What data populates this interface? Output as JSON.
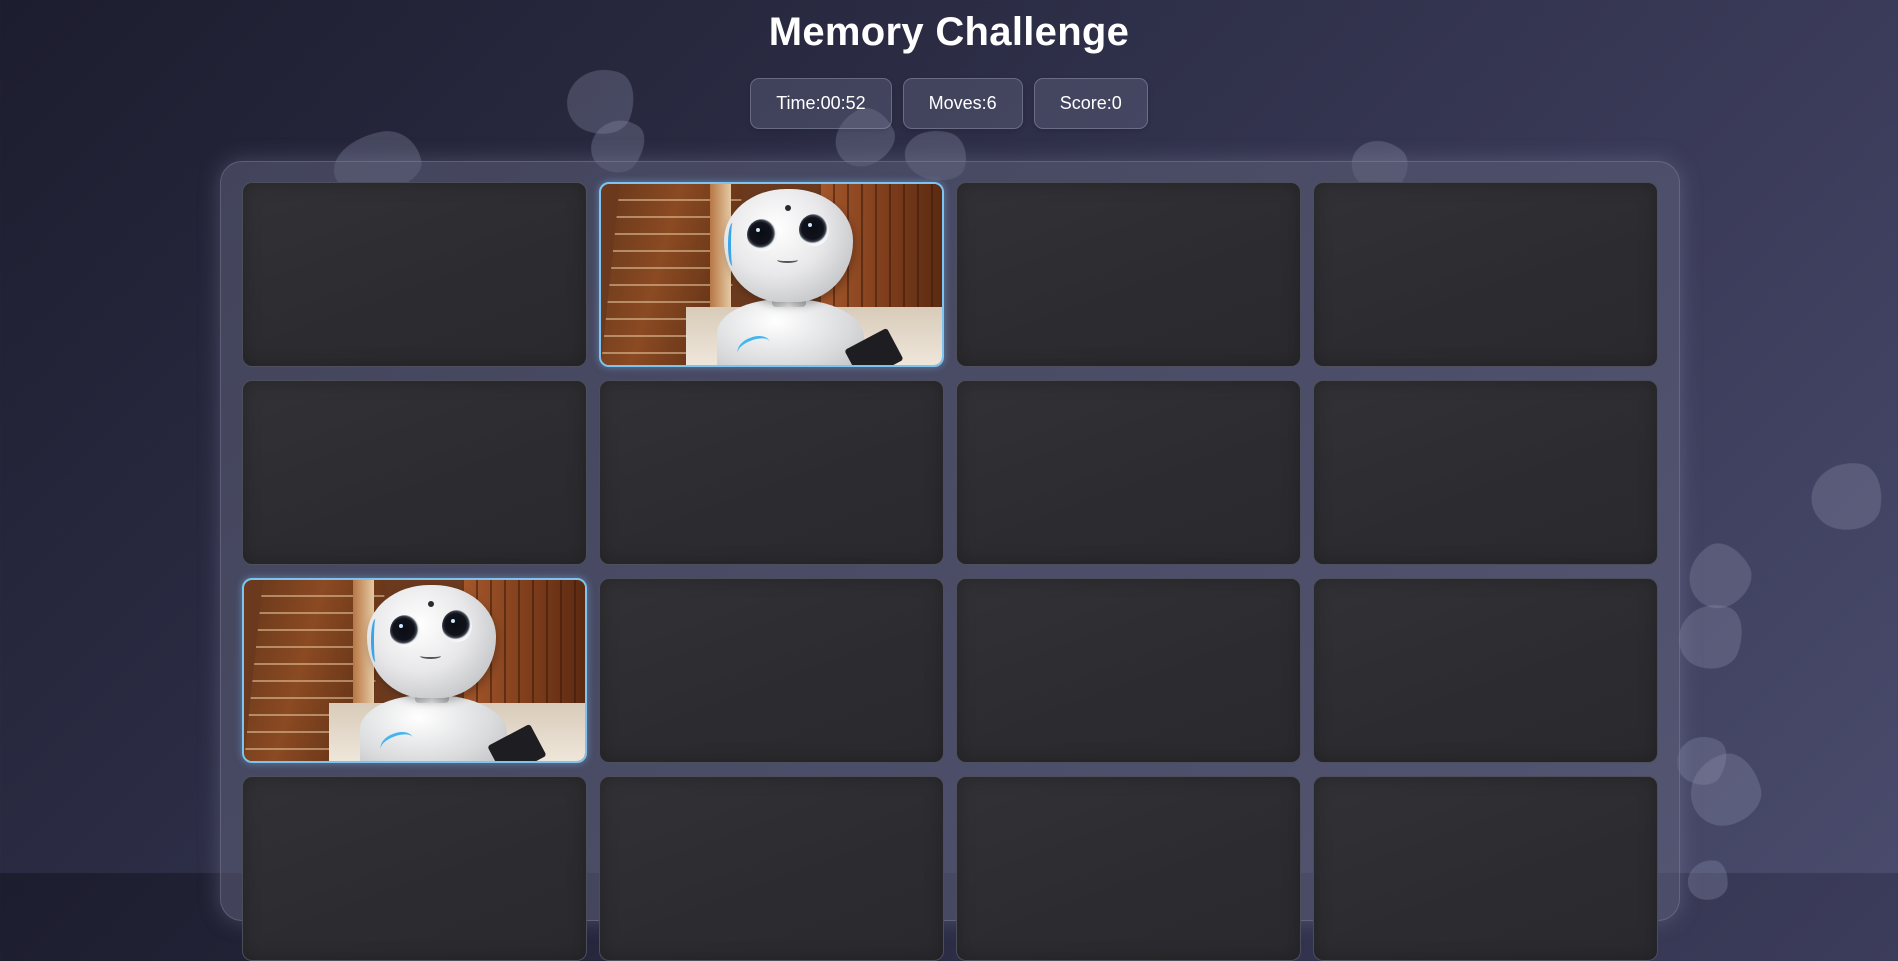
{
  "title": "Memory Challenge",
  "stats": {
    "time": {
      "label": "Time",
      "value": "00:52"
    },
    "moves": {
      "label": "Moves",
      "value": "6"
    },
    "score": {
      "label": "Score",
      "value": "0"
    }
  },
  "board": {
    "columns": 4,
    "cards": [
      {
        "state": "face-down",
        "icon": "card-back"
      },
      {
        "state": "face-up",
        "icon": "robot-photo"
      },
      {
        "state": "face-down",
        "icon": "card-back"
      },
      {
        "state": "face-down",
        "icon": "card-back"
      },
      {
        "state": "face-down",
        "icon": "card-back"
      },
      {
        "state": "face-down",
        "icon": "card-back"
      },
      {
        "state": "face-down",
        "icon": "card-back"
      },
      {
        "state": "face-down",
        "icon": "card-back"
      },
      {
        "state": "face-up",
        "icon": "robot-photo"
      },
      {
        "state": "face-down",
        "icon": "card-back"
      },
      {
        "state": "face-down",
        "icon": "card-back"
      },
      {
        "state": "face-down",
        "icon": "card-back"
      },
      {
        "state": "face-down",
        "icon": "card-back"
      },
      {
        "state": "face-down",
        "icon": "card-back"
      },
      {
        "state": "face-down",
        "icon": "card-back"
      },
      {
        "state": "face-down",
        "icon": "card-back"
      }
    ]
  },
  "colors": {
    "background": "#2b2c44",
    "card_back": "#2e2e32",
    "selected_border": "#7fc4f0"
  }
}
